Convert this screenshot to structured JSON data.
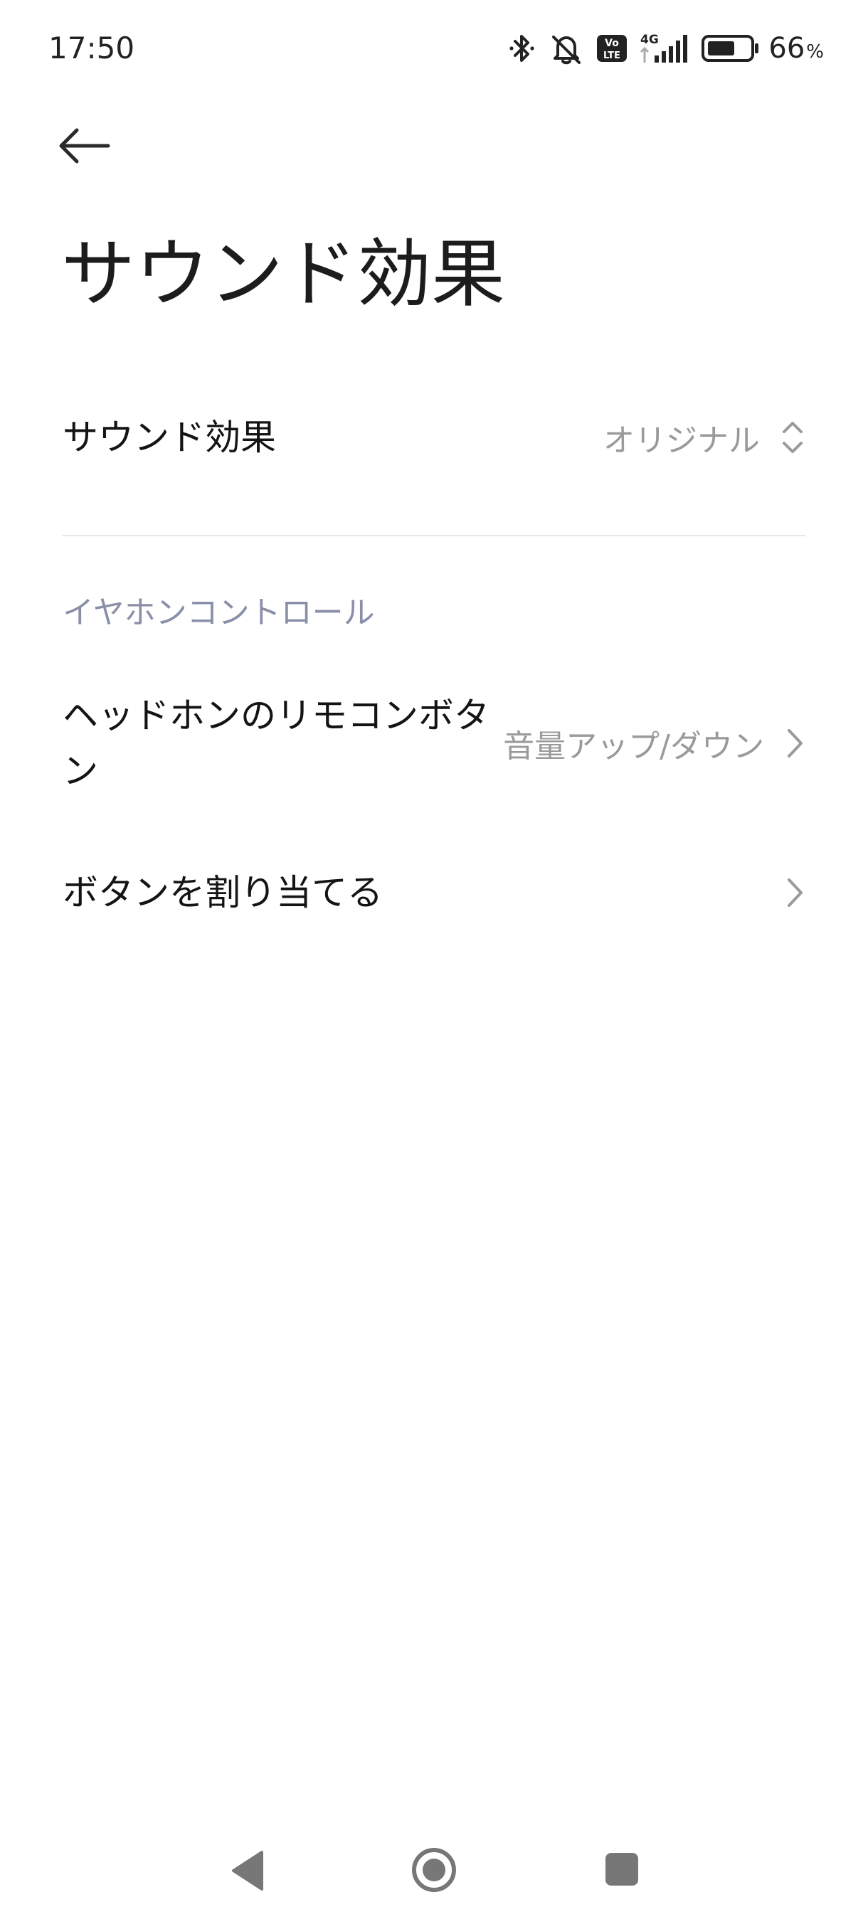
{
  "status_bar": {
    "time": "17:50",
    "icons": [
      "bluetooth-icon",
      "mute-icon",
      "volte-icon",
      "signal-4g-icon",
      "battery-icon"
    ],
    "network_label": "4G",
    "volte_line1": "Vo",
    "volte_line2": "LTE",
    "battery_percent": "66",
    "battery_unit": "%",
    "battery_level": 0.66
  },
  "header": {
    "back_icon": "arrow-left-icon",
    "title": "サウンド効果"
  },
  "settings": {
    "sound_effect": {
      "label": "サウンド効果",
      "value": "オリジナル",
      "icon": "chevron-up-down-icon"
    },
    "section_header": "イヤホンコントロール",
    "headphone_remote": {
      "label": "ヘッドホンのリモコンボタン",
      "value": "音量アップ/ダウン",
      "icon": "chevron-right-icon"
    },
    "assign_button": {
      "label": "ボタンを割り当てる",
      "icon": "chevron-right-icon"
    }
  },
  "nav_bar": {
    "icons": [
      "nav-back-icon",
      "nav-home-icon",
      "nav-recents-icon"
    ]
  },
  "colors": {
    "text_primary": "#141414",
    "text_secondary": "#9a9a9a",
    "section_header": "#8a8fa8",
    "divider": "#e6e6e6",
    "nav_icons": "#7a7a7a"
  }
}
